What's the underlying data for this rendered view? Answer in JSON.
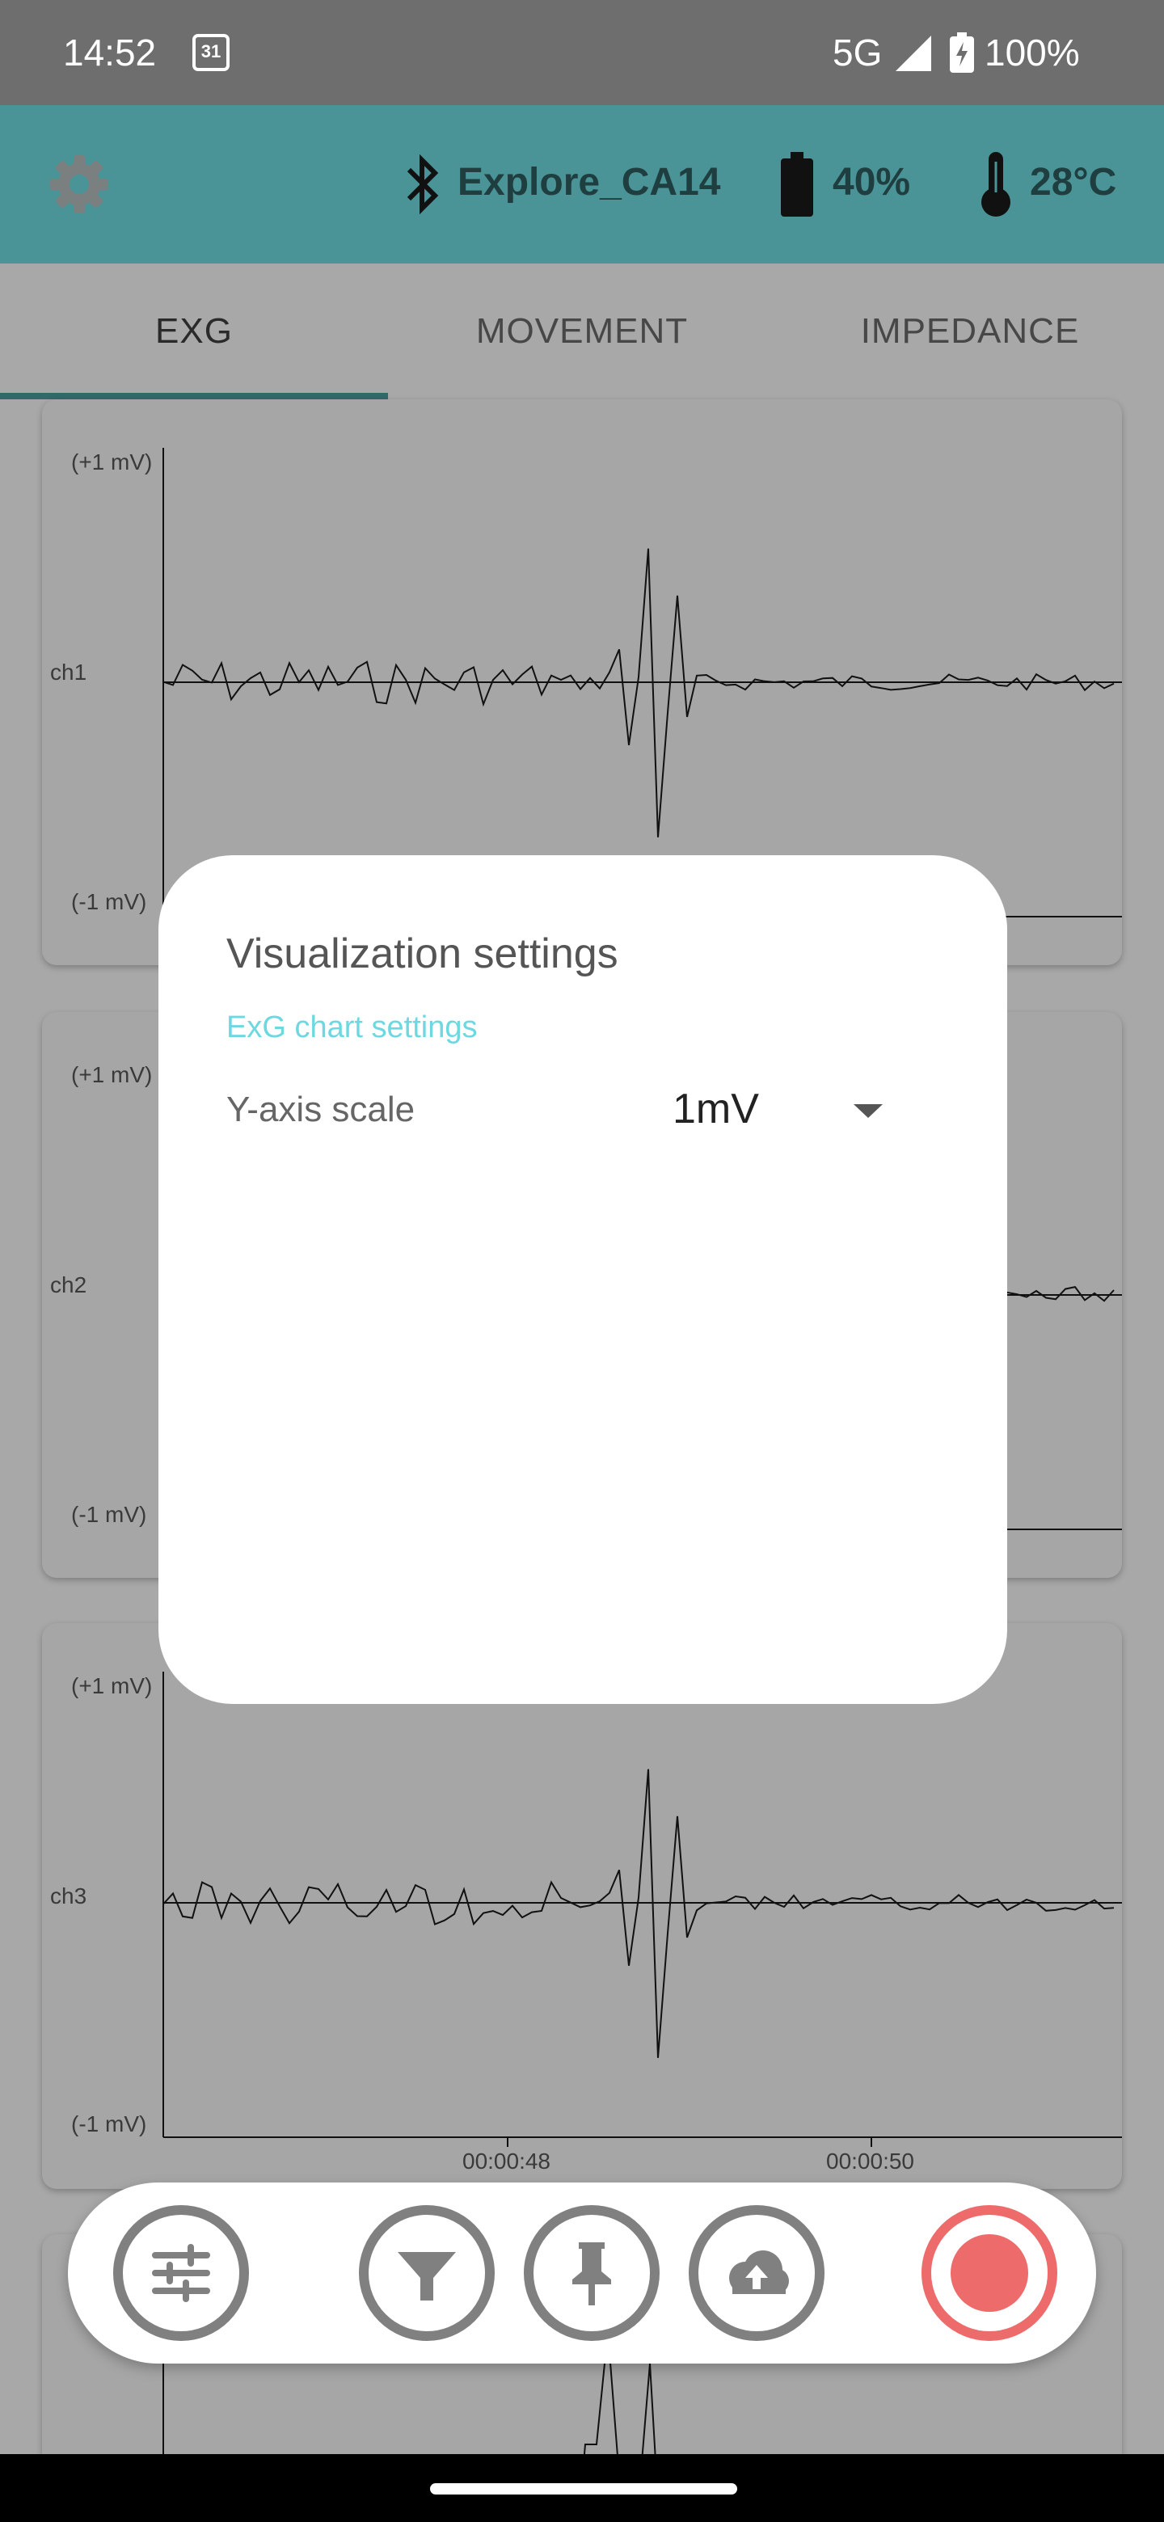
{
  "status_bar": {
    "time": "14:52",
    "calendar_day": "31",
    "network": "5G",
    "battery": "100%"
  },
  "app_bar": {
    "device_name": "Explore_CA14",
    "device_battery": "40%",
    "temperature": "28°C"
  },
  "tabs": [
    {
      "label": "EXG",
      "selected": true
    },
    {
      "label": "MOVEMENT",
      "selected": false
    },
    {
      "label": "IMPEDANCE",
      "selected": false
    }
  ],
  "charts": {
    "y_max_label": "(+1 mV)",
    "y_min_label": "(-1 mV)",
    "channels": [
      "ch1",
      "ch2",
      "ch3"
    ],
    "x_ticks": [
      "00:00:48",
      "00:00:50"
    ]
  },
  "dialog": {
    "title": "Visualization settings",
    "section": "ExG chart settings",
    "y_scale_label": "Y-axis scale",
    "y_scale_value": "1mV"
  },
  "colors": {
    "app_bar": "#4a9397",
    "accent": "#6dd8e0",
    "record": "#ee6b6b"
  },
  "toolbar_icons": [
    "sliders-icon",
    "filter-icon",
    "pin-icon",
    "cloud-upload-icon",
    "record-icon"
  ]
}
